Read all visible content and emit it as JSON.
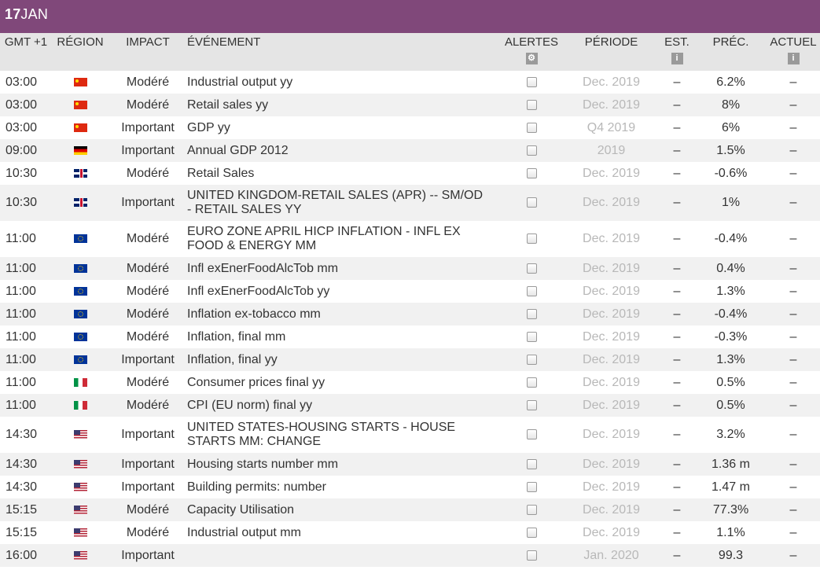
{
  "day": {
    "number": "17",
    "month": "JAN"
  },
  "columns": {
    "time": "GMT +1",
    "region": "RÉGION",
    "impact": "IMPACT",
    "event": "ÉVÉNEMENT",
    "alerts": "ALERTES",
    "period": "PÉRIODE",
    "est": "EST.",
    "prev": "PRÉC.",
    "actual": "ACTUEL"
  },
  "icons": {
    "alerts": "gear-icon",
    "est": "info-icon",
    "actual": "info-icon"
  },
  "rows": [
    {
      "time": "03:00",
      "flag": "cn",
      "impact": "Modéré",
      "event": "Industrial output yy",
      "period": "Dec. 2019",
      "est": "–",
      "prev": "6.2%",
      "actual": "–"
    },
    {
      "time": "03:00",
      "flag": "cn",
      "impact": "Modéré",
      "event": "Retail sales yy",
      "period": "Dec. 2019",
      "est": "–",
      "prev": "8%",
      "actual": "–"
    },
    {
      "time": "03:00",
      "flag": "cn",
      "impact": "Important",
      "event": "GDP yy",
      "period": "Q4 2019",
      "est": "–",
      "prev": "6%",
      "actual": "–"
    },
    {
      "time": "09:00",
      "flag": "de",
      "impact": "Important",
      "event": "Annual GDP 2012",
      "period": "2019",
      "est": "–",
      "prev": "1.5%",
      "actual": "–"
    },
    {
      "time": "10:30",
      "flag": "gb",
      "impact": "Modéré",
      "event": "Retail Sales",
      "period": "Dec. 2019",
      "est": "–",
      "prev": "-0.6%",
      "actual": "–"
    },
    {
      "time": "10:30",
      "flag": "gb",
      "impact": "Important",
      "event": "UNITED KINGDOM-RETAIL SALES (APR) -- SM/OD - RETAIL SALES YY",
      "period": "Dec. 2019",
      "est": "–",
      "prev": "1%",
      "actual": "–",
      "tall": true
    },
    {
      "time": "11:00",
      "flag": "eu",
      "impact": "Modéré",
      "event": "EURO ZONE APRIL HICP INFLATION - INFL EX FOOD & ENERGY MM",
      "period": "Dec. 2019",
      "est": "–",
      "prev": "-0.4%",
      "actual": "–",
      "tall": true
    },
    {
      "time": "11:00",
      "flag": "eu",
      "impact": "Modéré",
      "event": "Infl exEnerFoodAlcTob mm",
      "period": "Dec. 2019",
      "est": "–",
      "prev": "0.4%",
      "actual": "–"
    },
    {
      "time": "11:00",
      "flag": "eu",
      "impact": "Modéré",
      "event": "Infl exEnerFoodAlcTob yy",
      "period": "Dec. 2019",
      "est": "–",
      "prev": "1.3%",
      "actual": "–"
    },
    {
      "time": "11:00",
      "flag": "eu",
      "impact": "Modéré",
      "event": "Inflation ex-tobacco mm",
      "period": "Dec. 2019",
      "est": "–",
      "prev": "-0.4%",
      "actual": "–"
    },
    {
      "time": "11:00",
      "flag": "eu",
      "impact": "Modéré",
      "event": "Inflation, final mm",
      "period": "Dec. 2019",
      "est": "–",
      "prev": "-0.3%",
      "actual": "–"
    },
    {
      "time": "11:00",
      "flag": "eu",
      "impact": "Important",
      "event": "Inflation, final yy",
      "period": "Dec. 2019",
      "est": "–",
      "prev": "1.3%",
      "actual": "–"
    },
    {
      "time": "11:00",
      "flag": "it",
      "impact": "Modéré",
      "event": "Consumer prices final yy",
      "period": "Dec. 2019",
      "est": "–",
      "prev": "0.5%",
      "actual": "–"
    },
    {
      "time": "11:00",
      "flag": "it",
      "impact": "Modéré",
      "event": "CPI (EU norm) final yy",
      "period": "Dec. 2019",
      "est": "–",
      "prev": "0.5%",
      "actual": "–"
    },
    {
      "time": "14:30",
      "flag": "us",
      "impact": "Important",
      "event": "UNITED STATES-HOUSING STARTS - HOUSE STARTS MM: CHANGE",
      "period": "Dec. 2019",
      "est": "–",
      "prev": "3.2%",
      "actual": "–",
      "tall": true
    },
    {
      "time": "14:30",
      "flag": "us",
      "impact": "Important",
      "event": "Housing starts number mm",
      "period": "Dec. 2019",
      "est": "–",
      "prev": "1.36 m",
      "actual": "–"
    },
    {
      "time": "14:30",
      "flag": "us",
      "impact": "Important",
      "event": "Building permits: number",
      "period": "Dec. 2019",
      "est": "–",
      "prev": "1.47 m",
      "actual": "–"
    },
    {
      "time": "15:15",
      "flag": "us",
      "impact": "Modéré",
      "event": "Capacity Utilisation",
      "period": "Dec. 2019",
      "est": "–",
      "prev": "77.3%",
      "actual": "–"
    },
    {
      "time": "15:15",
      "flag": "us",
      "impact": "Modéré",
      "event": "Industrial output mm",
      "period": "Dec. 2019",
      "est": "–",
      "prev": "1.1%",
      "actual": "–"
    },
    {
      "time": "16:00",
      "flag": "us",
      "impact": "Important",
      "event": "",
      "period": "Jan. 2020",
      "est": "–",
      "prev": "99.3",
      "actual": "–"
    }
  ],
  "colors": {
    "daybar": "#80487a",
    "header": "#e5e5e5",
    "stripe": "#f1f1f1",
    "period": "#b8b8b8"
  }
}
